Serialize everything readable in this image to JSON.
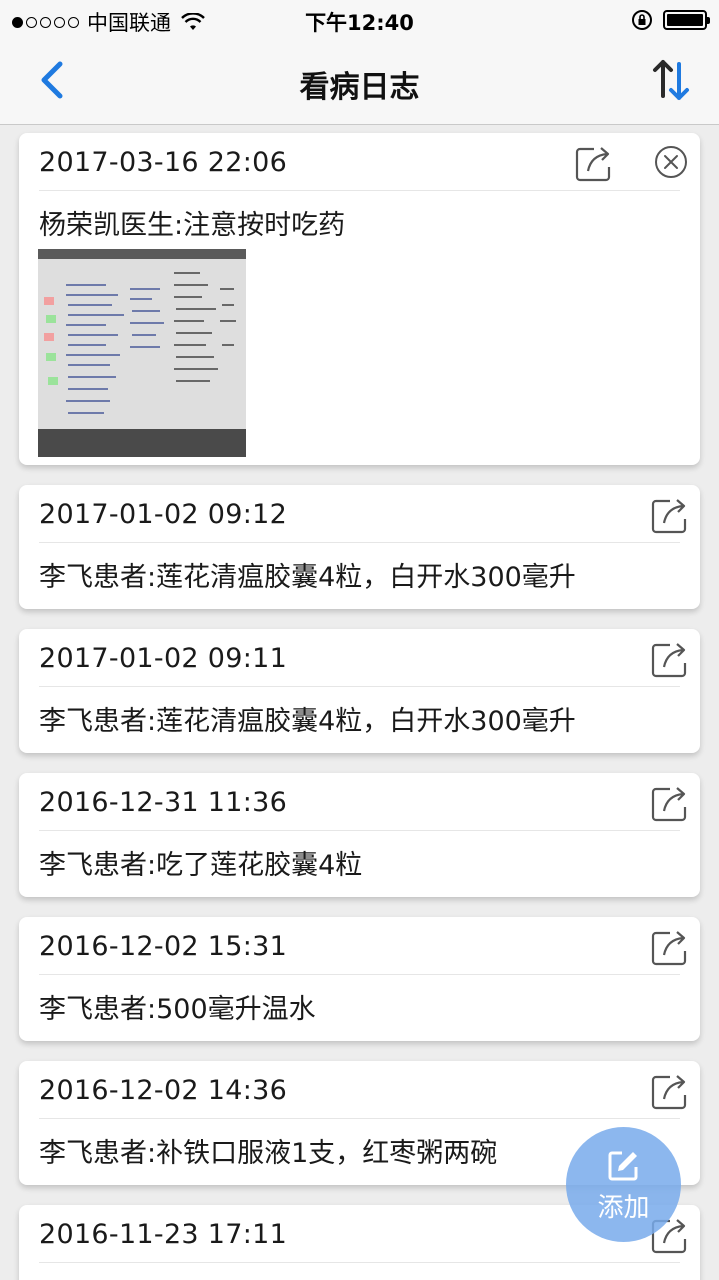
{
  "status_bar": {
    "carrier": "中国联通",
    "time": "下午12:40"
  },
  "nav": {
    "title": "看病日志",
    "back_icon": "chevron-left-icon",
    "sort_icon": "sort-arrows-icon"
  },
  "entries": [
    {
      "date": "2017-03-16 22:06",
      "text": "杨荣凯医生:注意按时吃药",
      "has_image": true,
      "has_close": true
    },
    {
      "date": "2017-01-02 09:12",
      "text": "李飞患者:莲花清瘟胶囊4粒，白开水300毫升"
    },
    {
      "date": "2017-01-02 09:11",
      "text": "李飞患者:莲花清瘟胶囊4粒，白开水300毫升"
    },
    {
      "date": "2016-12-31 11:36",
      "text": "李飞患者:吃了莲花胶囊4粒"
    },
    {
      "date": "2016-12-02 15:31",
      "text": "李飞患者:500毫升温水"
    },
    {
      "date": "2016-12-02 14:36",
      "text": "李飞患者:补铁口服液1支，红枣粥两碗"
    },
    {
      "date": "2016-11-23 17:11",
      "text": ""
    }
  ],
  "fab": {
    "label": "添加",
    "icon": "edit-icon"
  },
  "colors": {
    "accent": "#1f7ae0",
    "fab": "#78aaeb",
    "background": "#ededed"
  }
}
